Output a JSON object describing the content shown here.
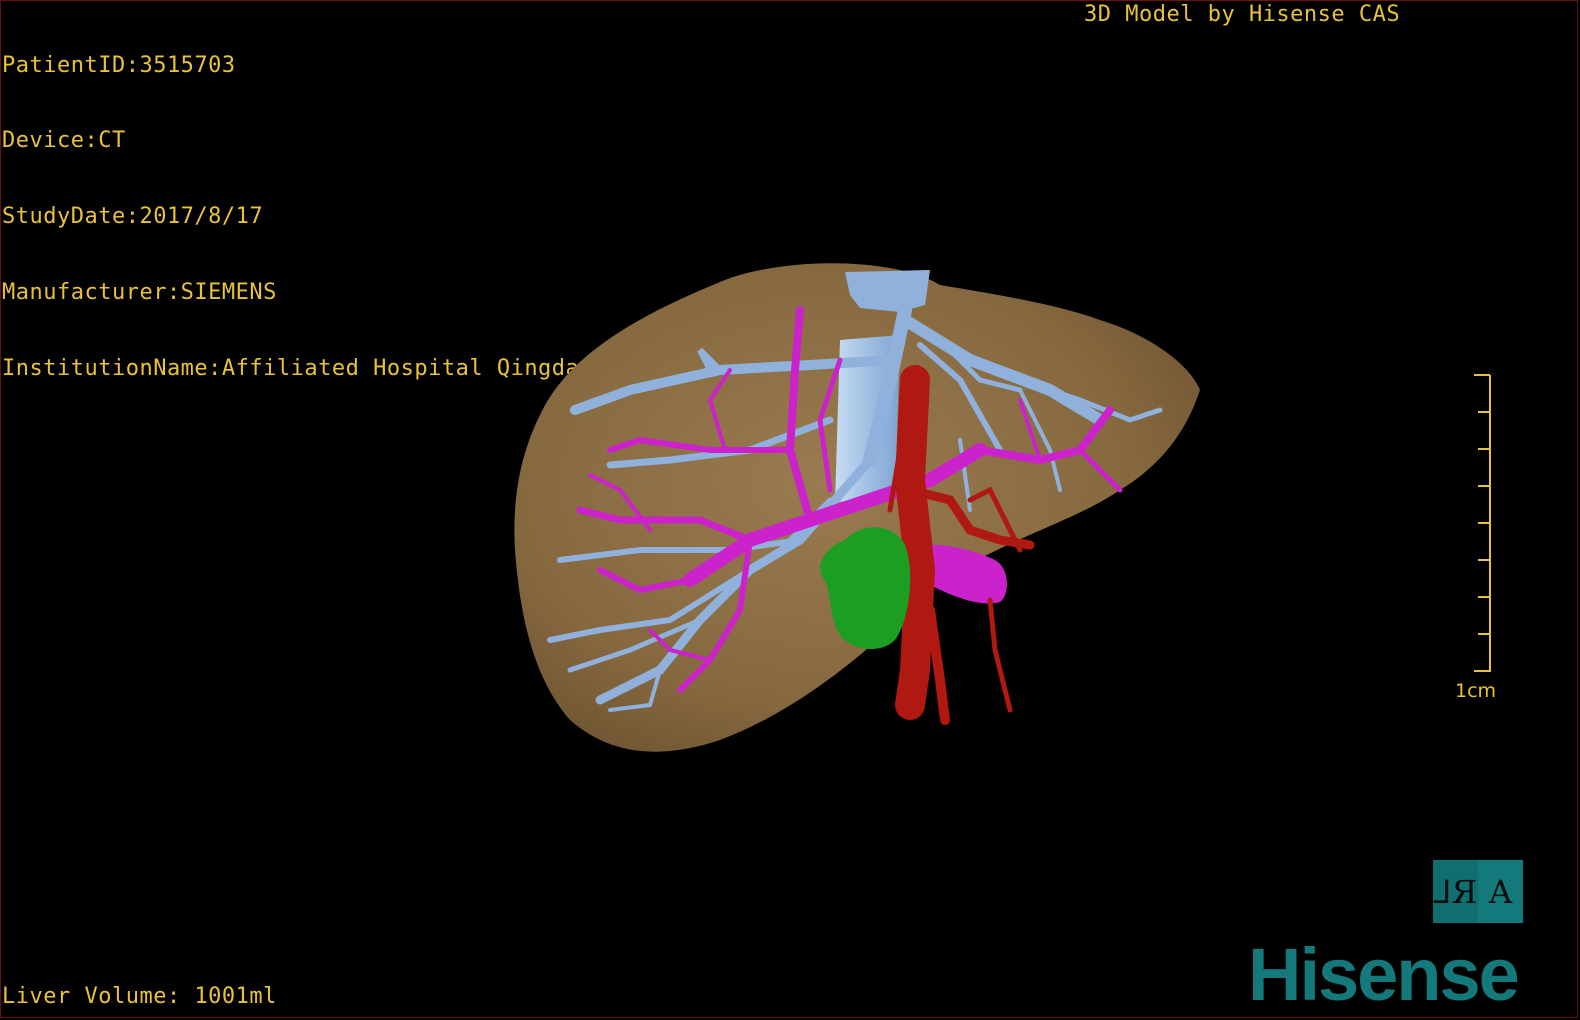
{
  "header": {
    "patient_id": "PatientID:3515703",
    "device": "Device:CT",
    "study_date": "StudyDate:2017/8/17",
    "manufacturer": "Manufacturer:SIEMENS",
    "institution": "InstitutionName:Affiliated Hospital Qingdao University-C"
  },
  "credit": "3D Model by Hisense CAS",
  "footer": {
    "liver_volume": "Liver Volume: 1001ml"
  },
  "scale": {
    "label": "1cm"
  },
  "view_toggle": {
    "left_glyph": "⅃Я",
    "right_glyph": "A"
  },
  "brand": {
    "logo_text": "Hisense"
  },
  "colors": {
    "overlay_text": "#e8c23a",
    "liver": "#8b6d45",
    "hepatic_vein": "#8fb1dc",
    "portal_vein": "#cc22cc",
    "artery": "#b01812",
    "gallbladder": "#1c9e22",
    "brand": "#13797a"
  },
  "model": {
    "structures": [
      "liver",
      "hepatic-vein",
      "portal-vein",
      "hepatic-artery",
      "gallbladder",
      "inferior-vena-cava"
    ]
  }
}
